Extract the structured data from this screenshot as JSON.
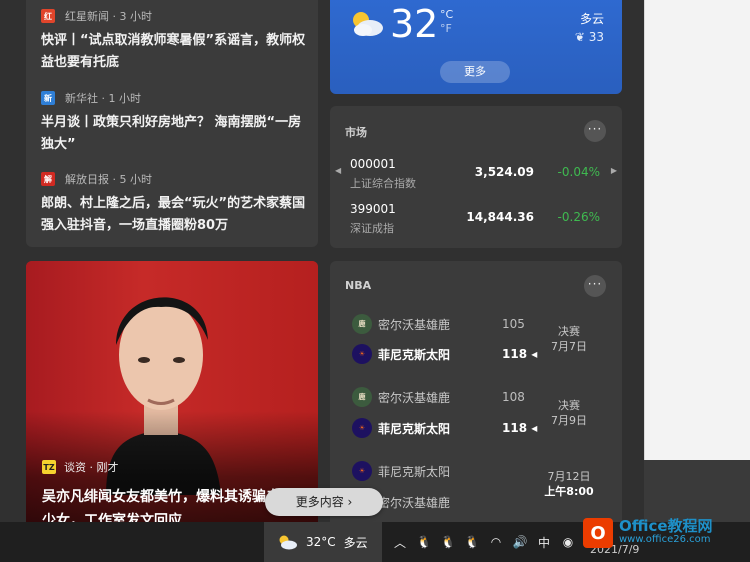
{
  "news": [
    {
      "source": "红星新闻 · 3 小时",
      "logo_text": "红",
      "logo_color": "#e0452b",
      "title": "快评丨“试点取消教师寒暑假”系谣言，教师权益也要有托底"
    },
    {
      "source": "新华社 · 1 小时",
      "logo_text": "新",
      "logo_color": "#2f7fd6",
      "title": "半月谈丨政策只利好房地产？ 海南摆脱“一房独大”"
    },
    {
      "source": "解放日报 · 5 小时",
      "logo_text": "解",
      "logo_color": "#d12a22",
      "title": "郎朗、村上隆之后，最会“玩火”的艺术家蔡国强入驻抖音，一场直播圈粉80万"
    }
  ],
  "weather": {
    "temp": "32",
    "unit_c": "°C",
    "unit_f": "°F",
    "condition": "多云",
    "aqi": "33",
    "more_label": "更多",
    "icon": "partly-cloudy-icon"
  },
  "market": {
    "title": "市场",
    "more": "···",
    "stocks": [
      {
        "code": "000001",
        "name": "上证综合指数",
        "price": "3,524.09",
        "change": "-0.04%"
      },
      {
        "code": "399001",
        "name": "深证成指",
        "price": "14,844.36",
        "change": "-0.26%"
      }
    ],
    "change_color": "#3fb950"
  },
  "nba": {
    "title": "NBA",
    "more": "···",
    "games": [
      {
        "team1": "密尔沃基雄鹿",
        "score1": "105",
        "team2": "菲尼克斯太阳",
        "score2": "118",
        "stage": "决赛",
        "date": "7月7日"
      },
      {
        "team1": "密尔沃基雄鹿",
        "score1": "108",
        "team2": "菲尼克斯太阳",
        "score2": "118",
        "stage": "决赛",
        "date": "7月9日"
      },
      {
        "team1": "菲尼克斯太阳",
        "team2": "密尔沃基雄鹿",
        "date": "7月12日",
        "time": "上午8:00"
      }
    ]
  },
  "photo_news": {
    "source": "谈资 · 刚才",
    "logo_text": "TZ",
    "title": "吴亦凡绯闻女友都美竹，爆料其诱骗未成年少女，工作室发文回应"
  },
  "more_content": "更多内容 ›",
  "taskbar": {
    "weather_temp": "32°C",
    "weather_cond": "多云",
    "ime": "中",
    "date": "2021/7/9"
  },
  "watermark": {
    "main": "Office教程网",
    "sub": "www.office26.com"
  }
}
